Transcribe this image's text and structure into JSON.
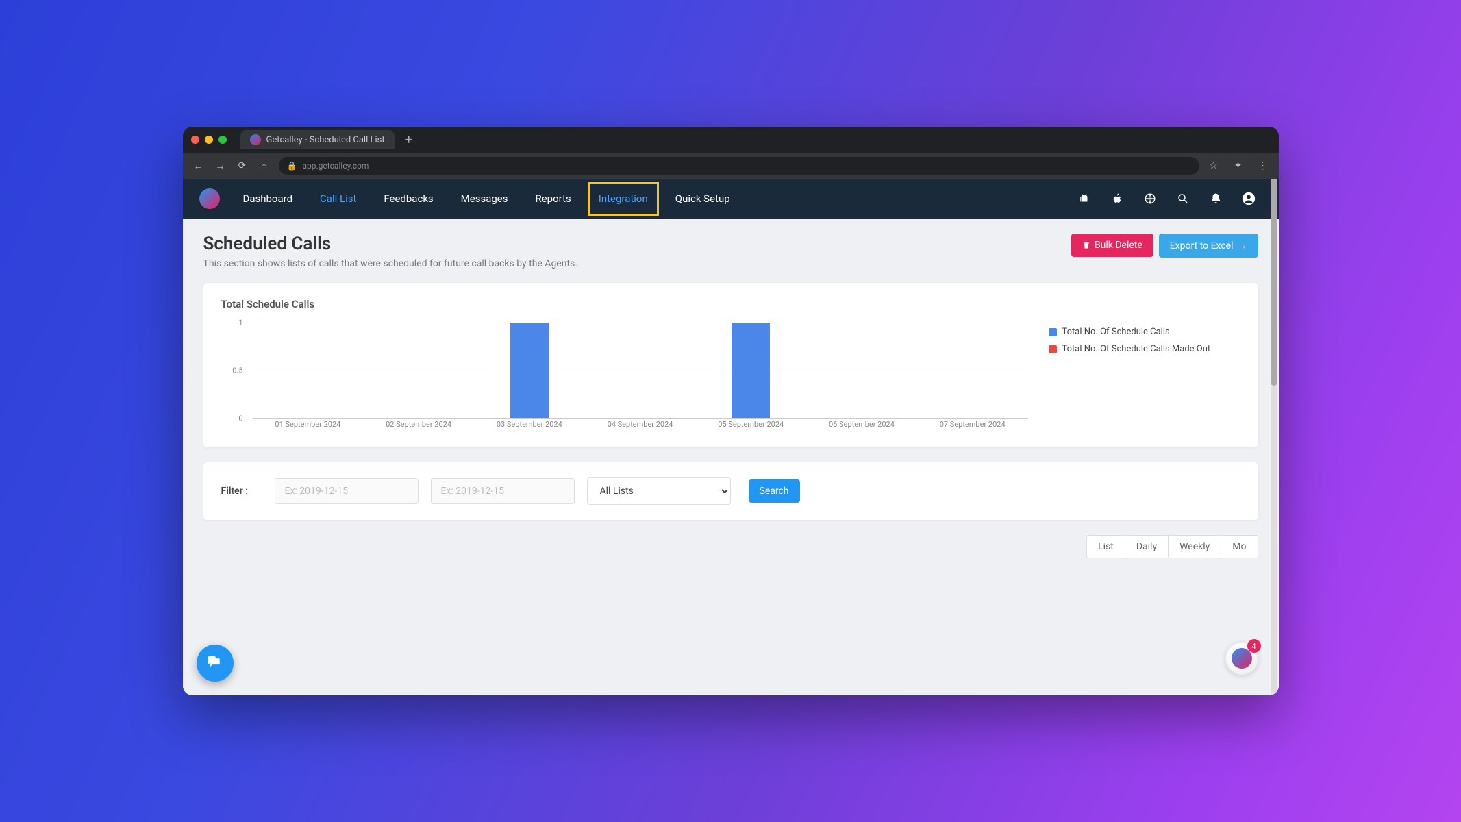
{
  "browser": {
    "tab_title": "Getcalley - Scheduled Call List",
    "url": "app.getcalley.com"
  },
  "nav": {
    "items": [
      "Dashboard",
      "Call List",
      "Feedbacks",
      "Messages",
      "Reports",
      "Integration",
      "Quick Setup"
    ],
    "active_index": 1,
    "highlighted_index": 5
  },
  "header": {
    "title": "Scheduled Calls",
    "subtitle": "This section shows lists of calls that were scheduled for future call backs by the Agents.",
    "bulk_delete_label": "Bulk Delete",
    "export_label": "Export to Excel"
  },
  "chart_data": {
    "type": "bar",
    "title": "Total Schedule Calls",
    "categories": [
      "01 September 2024",
      "02 September 2024",
      "03 September 2024",
      "04 September 2024",
      "05 September 2024",
      "06 September 2024",
      "07 September 2024"
    ],
    "series": [
      {
        "name": "Total No. Of Schedule Calls",
        "color": "#4a87e8",
        "values": [
          0,
          0,
          1,
          0,
          1,
          0,
          0
        ]
      },
      {
        "name": "Total No. Of Schedule Calls Made Out",
        "color": "#e64a3c",
        "values": [
          0,
          0,
          0,
          0,
          0,
          0,
          0
        ]
      }
    ],
    "ylim": [
      0,
      1
    ],
    "yticks": [
      0,
      0.5,
      1
    ]
  },
  "filter": {
    "label": "Filter :",
    "from_placeholder": "Ex: 2019-12-15",
    "to_placeholder": "Ex: 2019-12-15",
    "list_selected": "All Lists",
    "search_label": "Search"
  },
  "view_tabs": [
    "List",
    "Daily",
    "Weekly",
    "Mo"
  ],
  "float_badge": "4"
}
